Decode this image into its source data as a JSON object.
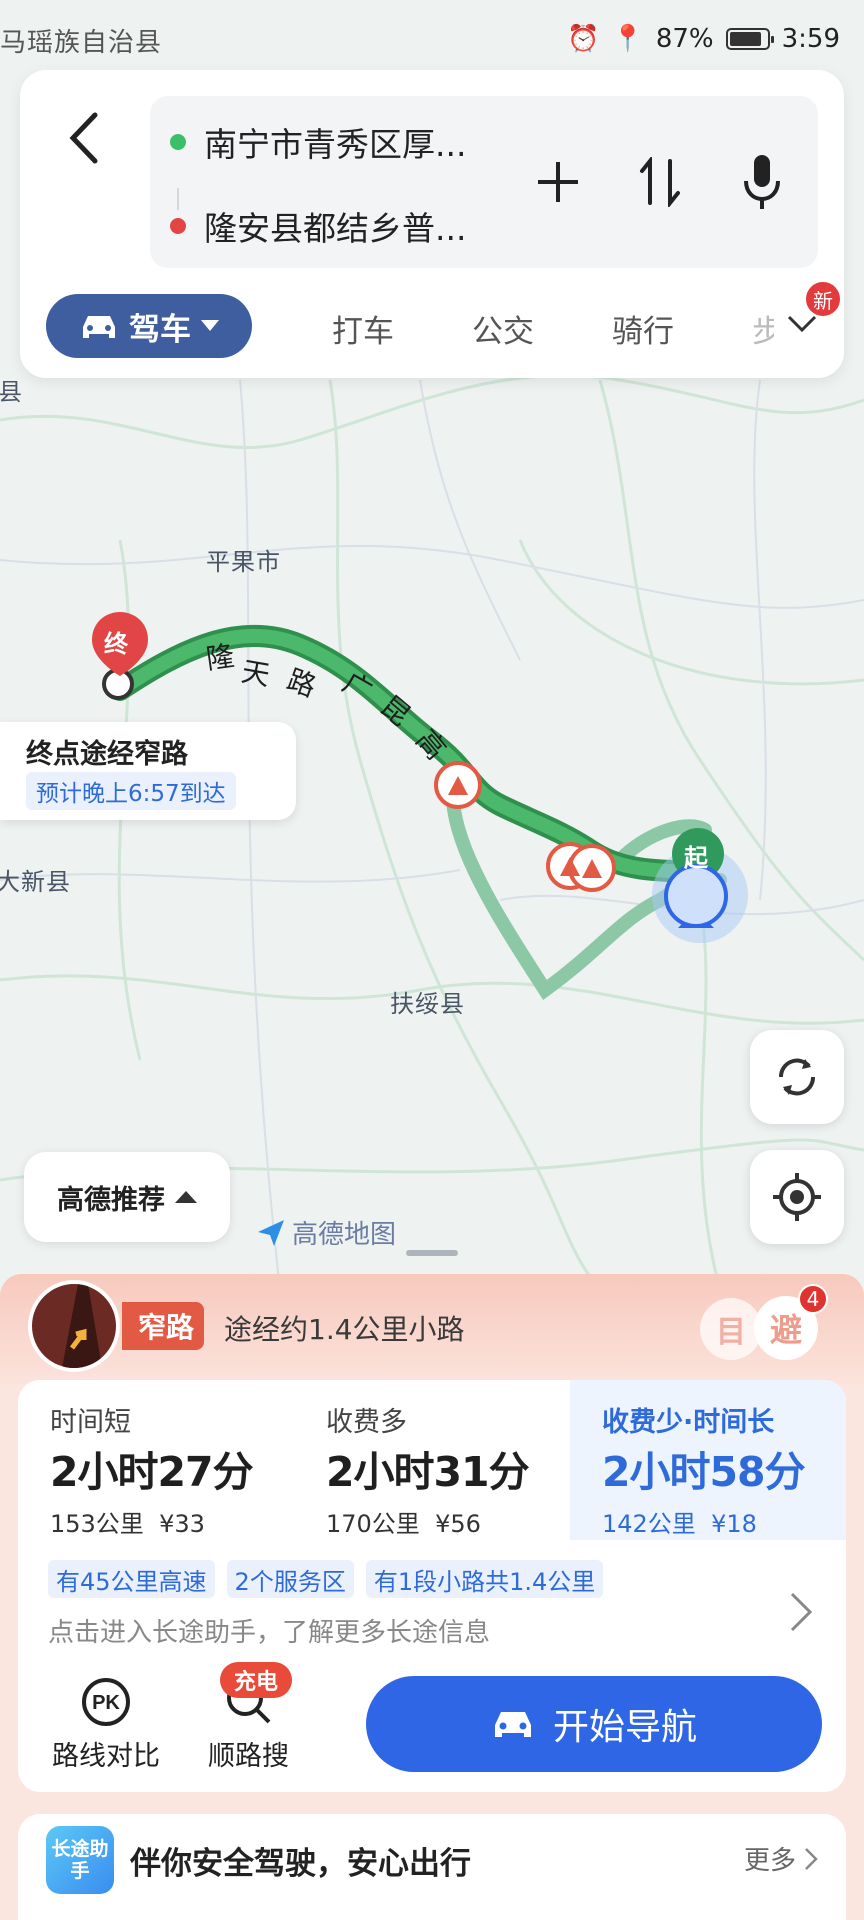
{
  "status_bar": {
    "left_apps": "马瑶族自治县",
    "battery": "87%",
    "battery_level": 0.87,
    "time": "3:59"
  },
  "route_card": {
    "origin": "南宁市青秀区厚...",
    "destination": "隆安县都结乡普...",
    "modes": [
      {
        "label": "驾车",
        "active": true
      },
      {
        "label": "打车"
      },
      {
        "label": "公交"
      },
      {
        "label": "骑行"
      },
      {
        "label": "步"
      }
    ],
    "new_badge": "新"
  },
  "map": {
    "labels": {
      "pingguo": "平果市",
      "fusui": "扶绥县",
      "daxin": "大新县",
      "xian": "县",
      "road_names": [
        "隆",
        "天",
        "路",
        "广",
        "昆",
        "高"
      ]
    },
    "end_marker": "终",
    "start_marker": "起",
    "dest_popup": {
      "title": "终点途经窄路",
      "eta": "预计晚上6:57到达"
    },
    "recommend": "高德推荐",
    "watermark": "高德地图"
  },
  "sheet": {
    "narrow_tag": "窄路",
    "narrow_desc": "途经约1.4公里小路",
    "avoid_label_1": "目",
    "avoid_label_2": "避",
    "avoid_count": "4",
    "routes": [
      {
        "label": "时间短",
        "duration": "2小时27分",
        "distance": "153公里",
        "toll": "¥33",
        "selected": false
      },
      {
        "label": "收费多",
        "duration": "2小时31分",
        "distance": "170公里",
        "toll": "¥56",
        "selected": false
      },
      {
        "label": "收费少·时间长",
        "duration": "2小时58分",
        "distance": "142公里",
        "toll": "¥18",
        "selected": true
      }
    ],
    "chips": [
      "有45公里高速",
      "2个服务区",
      "有1段小路共1.4公里"
    ],
    "long_tip": "点击进入长途助手，了解更多长途信息",
    "tools": {
      "compare": "路线对比",
      "along_search": "顺路搜",
      "charge_tag": "充电"
    },
    "start_nav": "开始导航",
    "safe": {
      "logo": "长途助手",
      "text": "伴你安全驾驶，安心出行",
      "more": "更多"
    }
  },
  "colors": {
    "accent_blue": "#2e66e6",
    "mode_active": "#3f5ea0",
    "route_green": "#3aa357",
    "narrow_red": "#e35a44"
  }
}
